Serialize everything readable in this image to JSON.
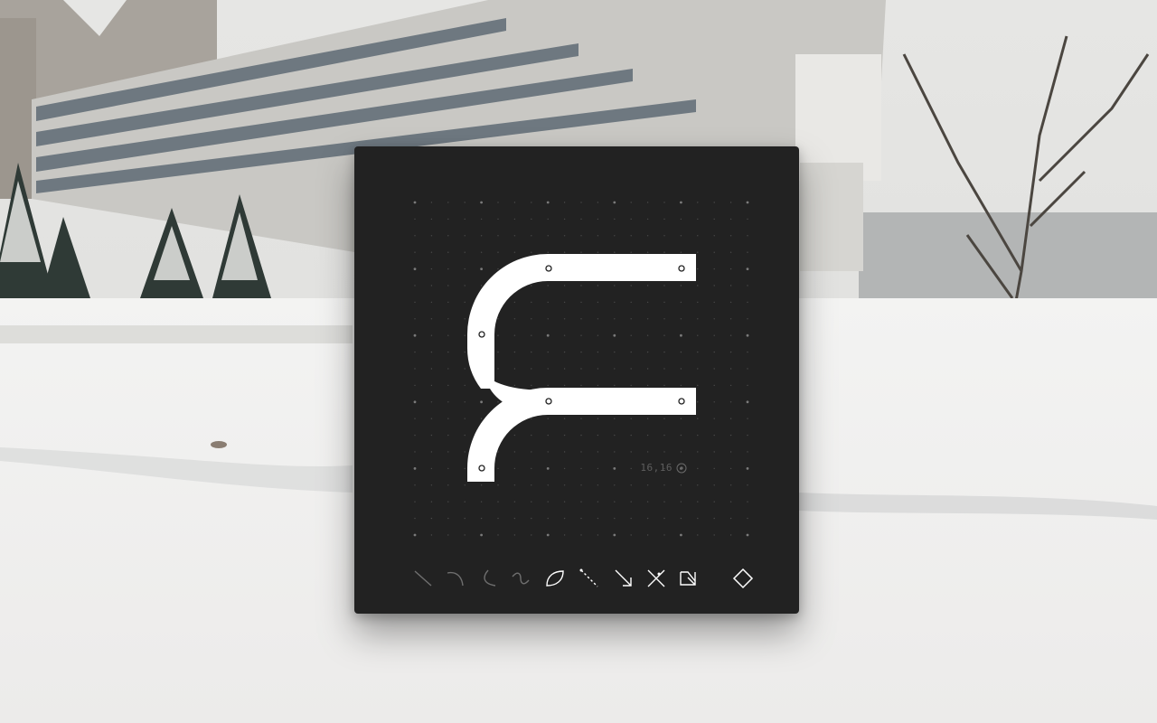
{
  "coordinate_readout": "16,16",
  "colors": {
    "panel_bg": "#222222",
    "glyph_fill": "#ffffff",
    "grid_dot": "#6a6a6a",
    "tool_dim": "#6f6f6f",
    "tool_active": "#ffffff"
  },
  "toolbar": {
    "tools": [
      {
        "icon": "line-tool-icon",
        "state": "inactive"
      },
      {
        "icon": "curve-tool-icon",
        "state": "inactive"
      },
      {
        "icon": "arc-tool-icon",
        "state": "inactive"
      },
      {
        "icon": "s-curve-tool-icon",
        "state": "inactive"
      },
      {
        "icon": "leaf-shape-tool-icon",
        "state": "active"
      },
      {
        "icon": "dashed-line-tool-icon",
        "state": "active"
      },
      {
        "icon": "arrow-tool-icon",
        "state": "active"
      },
      {
        "icon": "cross-tool-icon",
        "state": "active"
      },
      {
        "icon": "z-shape-tool-icon",
        "state": "active"
      },
      {
        "icon": "diamond-icon",
        "state": "active"
      }
    ]
  }
}
